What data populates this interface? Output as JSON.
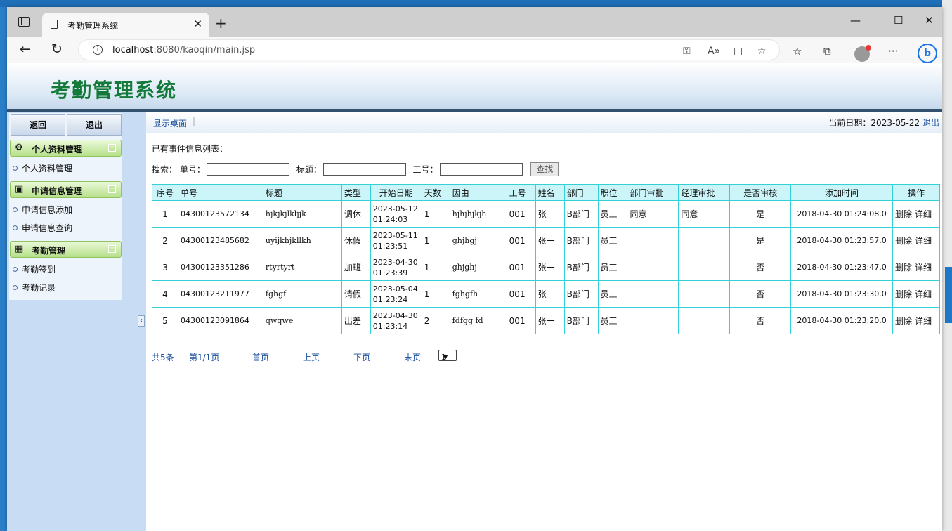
{
  "browser": {
    "tab_title": "考勤管理系统",
    "url_host": "localhost",
    "url_path": ":8080/kaoqin/main.jsp",
    "tab_close": "✕",
    "new_tab": "+",
    "minimize": "—",
    "maximize": "☐",
    "close": "✕",
    "back": "←",
    "refresh": "↻",
    "info": "i",
    "key_icon": "⚿",
    "read_aloud": "A»",
    "split_icon": "◫",
    "fav_add_icon": "☆",
    "favorites_icon": "☆",
    "collections_icon": "⧉",
    "more_icon": "···",
    "bing": "b"
  },
  "header": {
    "title": "考勤管理系统"
  },
  "sidebar": {
    "back_button": "返回",
    "logout_button": "退出",
    "groups": [
      {
        "title": "个人资料管理",
        "icon": "⚙",
        "items": [
          "个人资料管理"
        ]
      },
      {
        "title": "申请信息管理",
        "icon": "▣",
        "items": [
          "申请信息添加",
          "申请信息查询"
        ]
      },
      {
        "title": "考勤管理",
        "icon": "▦",
        "items": [
          "考勤签到",
          "考勤记录"
        ]
      }
    ],
    "collapse_symbol": "−",
    "split_arrow": "‹"
  },
  "toolbar": {
    "desktop_link": "显示桌面",
    "separator": "|",
    "date_label": "当前日期：2023-05-22 ",
    "logout": "退出"
  },
  "main": {
    "list_title": "已有事件信息列表：",
    "search": {
      "label": "搜索：",
      "order_label": "单号：",
      "title_label": "标题：",
      "empno_label": "工号：",
      "button": "查找"
    },
    "columns": [
      "序号",
      "单号",
      "标题",
      "类型",
      "开始日期",
      "天数",
      "因由",
      "工号",
      "姓名",
      "部门",
      "职位",
      "部门审批",
      "经理审批",
      "是否审核",
      "添加时间",
      "操作"
    ],
    "rows": [
      {
        "seq": "1",
        "order_no": "04300123572134",
        "title": "hjkjkjlkljjk",
        "type": "调休",
        "start_date": "2023-05-12",
        "start_time": "01:24:03",
        "days": "1",
        "reason": "hjhjhjkjh",
        "emp_no": "001",
        "name": "张一",
        "dept": "B部门",
        "position": "员工",
        "dept_approval": "同意",
        "mgr_approval": "同意",
        "reviewed": "是",
        "added": "2018-04-30 01:24:08.0",
        "delete": "删除",
        "detail": "详细"
      },
      {
        "seq": "2",
        "order_no": "04300123485682",
        "title": "uyijkhjkllkh",
        "type": "休假",
        "start_date": "2023-05-11",
        "start_time": "01:23:51",
        "days": "1",
        "reason": "ghjhgj",
        "emp_no": "001",
        "name": "张一",
        "dept": "B部门",
        "position": "员工",
        "dept_approval": "",
        "mgr_approval": "",
        "reviewed": "是",
        "added": "2018-04-30 01:23:57.0",
        "delete": "删除",
        "detail": "详细"
      },
      {
        "seq": "3",
        "order_no": "04300123351286",
        "title": "rtyrtyrt",
        "type": "加班",
        "start_date": "2023-04-30",
        "start_time": "01:23:39",
        "days": "1",
        "reason": "ghjghj",
        "emp_no": "001",
        "name": "张一",
        "dept": "B部门",
        "position": "员工",
        "dept_approval": "",
        "mgr_approval": "",
        "reviewed": "否",
        "added": "2018-04-30 01:23:47.0",
        "delete": "删除",
        "detail": "详细"
      },
      {
        "seq": "4",
        "order_no": "04300123211977",
        "title": "fghgf",
        "type": "请假",
        "start_date": "2023-05-04",
        "start_time": "01:23:24",
        "days": "1",
        "reason": "fghgfh",
        "emp_no": "001",
        "name": "张一",
        "dept": "B部门",
        "position": "员工",
        "dept_approval": "",
        "mgr_approval": "",
        "reviewed": "否",
        "added": "2018-04-30 01:23:30.0",
        "delete": "删除",
        "detail": "详细"
      },
      {
        "seq": "5",
        "order_no": "04300123091864",
        "title": "qwqwe",
        "type": "出差",
        "start_date": "2023-04-30",
        "start_time": "01:23:14",
        "days": "2",
        "reason": "fdfgg fd",
        "emp_no": "001",
        "name": "张一",
        "dept": "B部门",
        "position": "员工",
        "dept_approval": "",
        "mgr_approval": "",
        "reviewed": "否",
        "added": "2018-04-30 01:23:20.0",
        "delete": "删除",
        "detail": "详细"
      }
    ],
    "pager": {
      "total": "共5条",
      "page": "第1/1页",
      "first": "首页",
      "prev": "上页",
      "next": "下页",
      "last": "末页",
      "selected": "1"
    }
  }
}
